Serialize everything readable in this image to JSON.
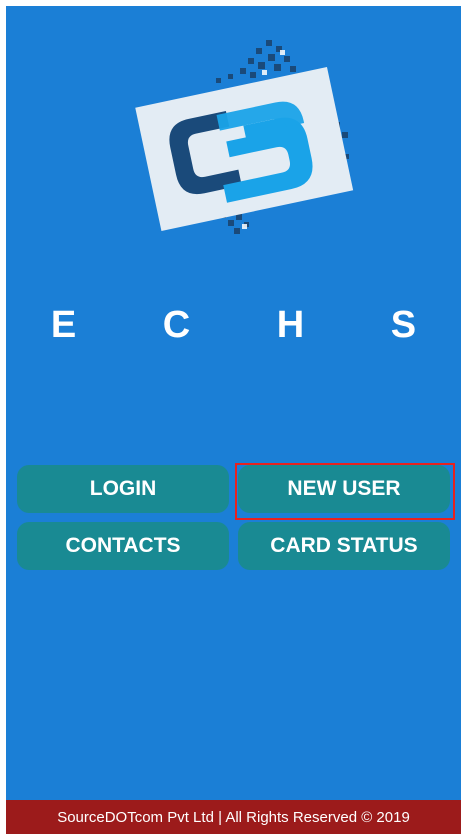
{
  "app": {
    "title": "E C H S"
  },
  "menu": {
    "buttons": [
      {
        "id": "login",
        "label": "LOGIN"
      },
      {
        "id": "new_user",
        "label": "NEW USER"
      },
      {
        "id": "contacts",
        "label": "CONTACTS"
      },
      {
        "id": "card_status",
        "label": "CARD STATUS"
      }
    ]
  },
  "footer": {
    "text": "SourceDOTcom Pvt Ltd | All Rights Reserved © 2019"
  },
  "colors": {
    "background": "#1b7fd6",
    "button": "#198a93",
    "footer": "#9c1b1b",
    "highlight": "#e8221f",
    "logo_dark": "#1a4a7a",
    "logo_light": "#1aa3e8"
  },
  "icons": {
    "logo": "cs-logo-icon"
  }
}
